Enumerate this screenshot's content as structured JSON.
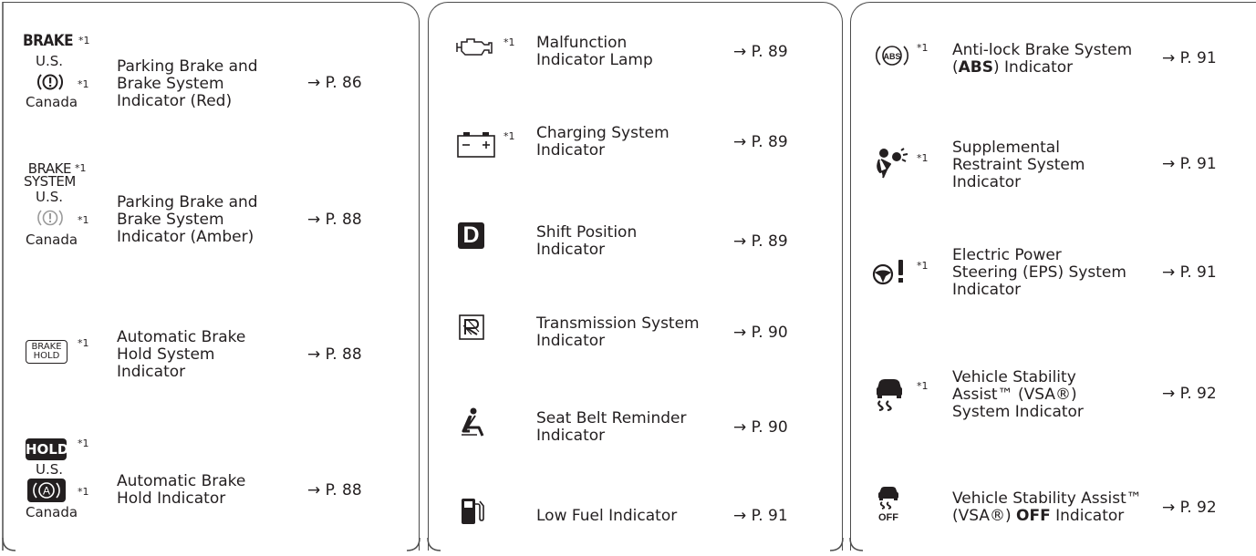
{
  "panel1": [
    {
      "lines": [
        "Parking Brake and",
        "Brake System",
        "Indicator (Red)"
      ],
      "ref": "→ P. 86",
      "icon_top": "BRAKE",
      "note_top": "*1",
      "region_top": "U.S.",
      "note_bottom": "*1",
      "region_bottom": "Canada",
      "icon": "brake-red-icon"
    },
    {
      "lines": [
        "Parking Brake and",
        "Brake System",
        "Indicator (Amber)"
      ],
      "ref": "→ P. 88",
      "icon_top1": "BRAKE",
      "icon_top2": "SYSTEM",
      "note_top": "*1",
      "region_top": "U.S.",
      "note_bottom": "*1",
      "region_bottom": "Canada",
      "icon": "brake-amber-icon"
    },
    {
      "lines": [
        "Automatic Brake",
        "Hold System",
        "Indicator"
      ],
      "ref": "→ P. 88",
      "icon_text1": "BRAKE",
      "icon_text2": "HOLD",
      "note": "*1",
      "icon": "brake-hold-system-icon"
    },
    {
      "lines": [
        "Automatic Brake",
        "Hold Indicator"
      ],
      "ref": "→ P. 88",
      "icon_text": "HOLD",
      "note_top": "*1",
      "region_top": "U.S.",
      "note_bottom": "*1",
      "region_bottom": "Canada",
      "icon": "brake-hold-indicator-icon"
    }
  ],
  "panel2": [
    {
      "lines": [
        "Malfunction",
        "Indicator Lamp"
      ],
      "ref": "→ P. 89",
      "note": "*1",
      "icon": "engine-icon"
    },
    {
      "lines": [
        "Charging System",
        "Indicator"
      ],
      "ref": "→ P. 89",
      "note": "*1",
      "icon": "battery-icon"
    },
    {
      "lines": [
        "Shift Position",
        "Indicator"
      ],
      "ref": "→ P. 89",
      "icon_text": "D",
      "icon": "shift-d-icon"
    },
    {
      "lines": [
        "Transmission System",
        "Indicator"
      ],
      "ref": "→ P. 90",
      "icon": "transmission-icon"
    },
    {
      "lines": [
        "Seat Belt Reminder",
        "Indicator"
      ],
      "ref": "→ P. 90",
      "icon": "seatbelt-icon"
    },
    {
      "lines": [
        "Low Fuel Indicator"
      ],
      "ref": "→ P. 91",
      "icon": "fuel-icon"
    }
  ],
  "panel3": [
    {
      "line1_pre": "Anti-lock Brake System",
      "line2_pre": "(",
      "line2_bold": "ABS",
      "line2_post": ") Indicator",
      "ref": "→ P. 91",
      "note": "*1",
      "icon_text": "ABS",
      "icon": "abs-icon"
    },
    {
      "lines": [
        "Supplemental",
        "Restraint System",
        "Indicator"
      ],
      "ref": "→ P. 91",
      "note": "*1",
      "icon": "airbag-icon"
    },
    {
      "lines": [
        "Electric Power",
        "Steering (EPS) System",
        "Indicator"
      ],
      "ref": "→ P. 91",
      "note": "*1",
      "icon": "eps-icon"
    },
    {
      "lines": [
        "Vehicle Stability",
        "Assist™ (VSA®)",
        "System Indicator"
      ],
      "ref": "→ P. 92",
      "note": "*1",
      "icon": "vsa-icon"
    },
    {
      "line1": "Vehicle Stability Assist™",
      "line2_pre": "(VSA®) ",
      "line2_bold": "OFF",
      "line2_post": " Indicator",
      "ref": "→ P. 92",
      "icon_text": "OFF",
      "icon": "vsa-off-icon"
    }
  ]
}
